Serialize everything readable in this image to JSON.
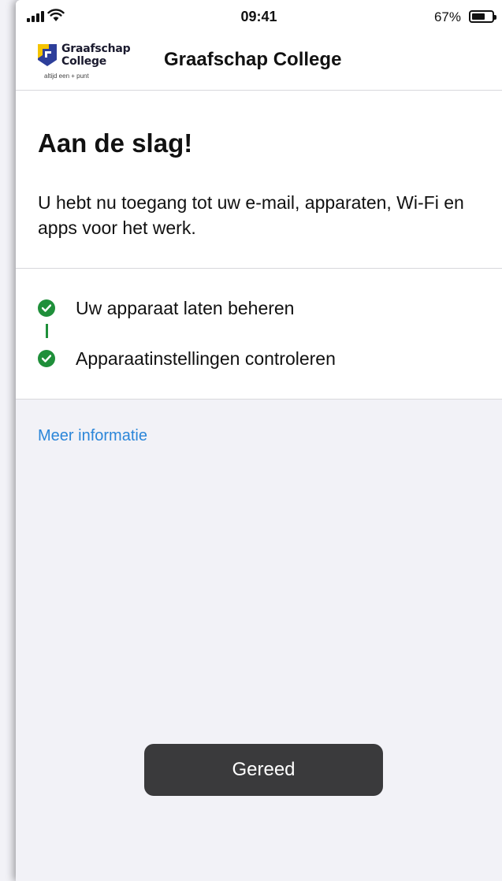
{
  "status_bar": {
    "time": "09:41",
    "battery_percent": "67%",
    "battery_level": 0.67,
    "signal_icon": "cellular-signal-icon",
    "wifi_icon": "wifi-icon",
    "battery_icon": "battery-icon"
  },
  "header": {
    "logo": {
      "line1": "Graafschap",
      "line2": "College",
      "tagline": "altijd een + punt",
      "colors": {
        "yellow": "#f5c400",
        "blue": "#2d3e9a"
      }
    },
    "title": "Graafschap College"
  },
  "main": {
    "heading": "Aan de slag!",
    "description": "U hebt nu toegang tot uw e-mail, apparaten, Wi-Fi en apps voor het werk.",
    "steps": [
      {
        "label": "Uw apparaat laten beheren",
        "status": "completed",
        "icon": "check-circle-icon"
      },
      {
        "label": "Apparaatinstellingen controleren",
        "status": "completed",
        "icon": "check-circle-icon"
      }
    ],
    "more_info_link": "Meer informatie"
  },
  "footer": {
    "done_button": "Gereed"
  },
  "colors": {
    "accent_link": "#2b86d9",
    "success": "#1f8f3a",
    "button_bg": "#3a3a3c",
    "page_bg": "#f2f2f7"
  }
}
